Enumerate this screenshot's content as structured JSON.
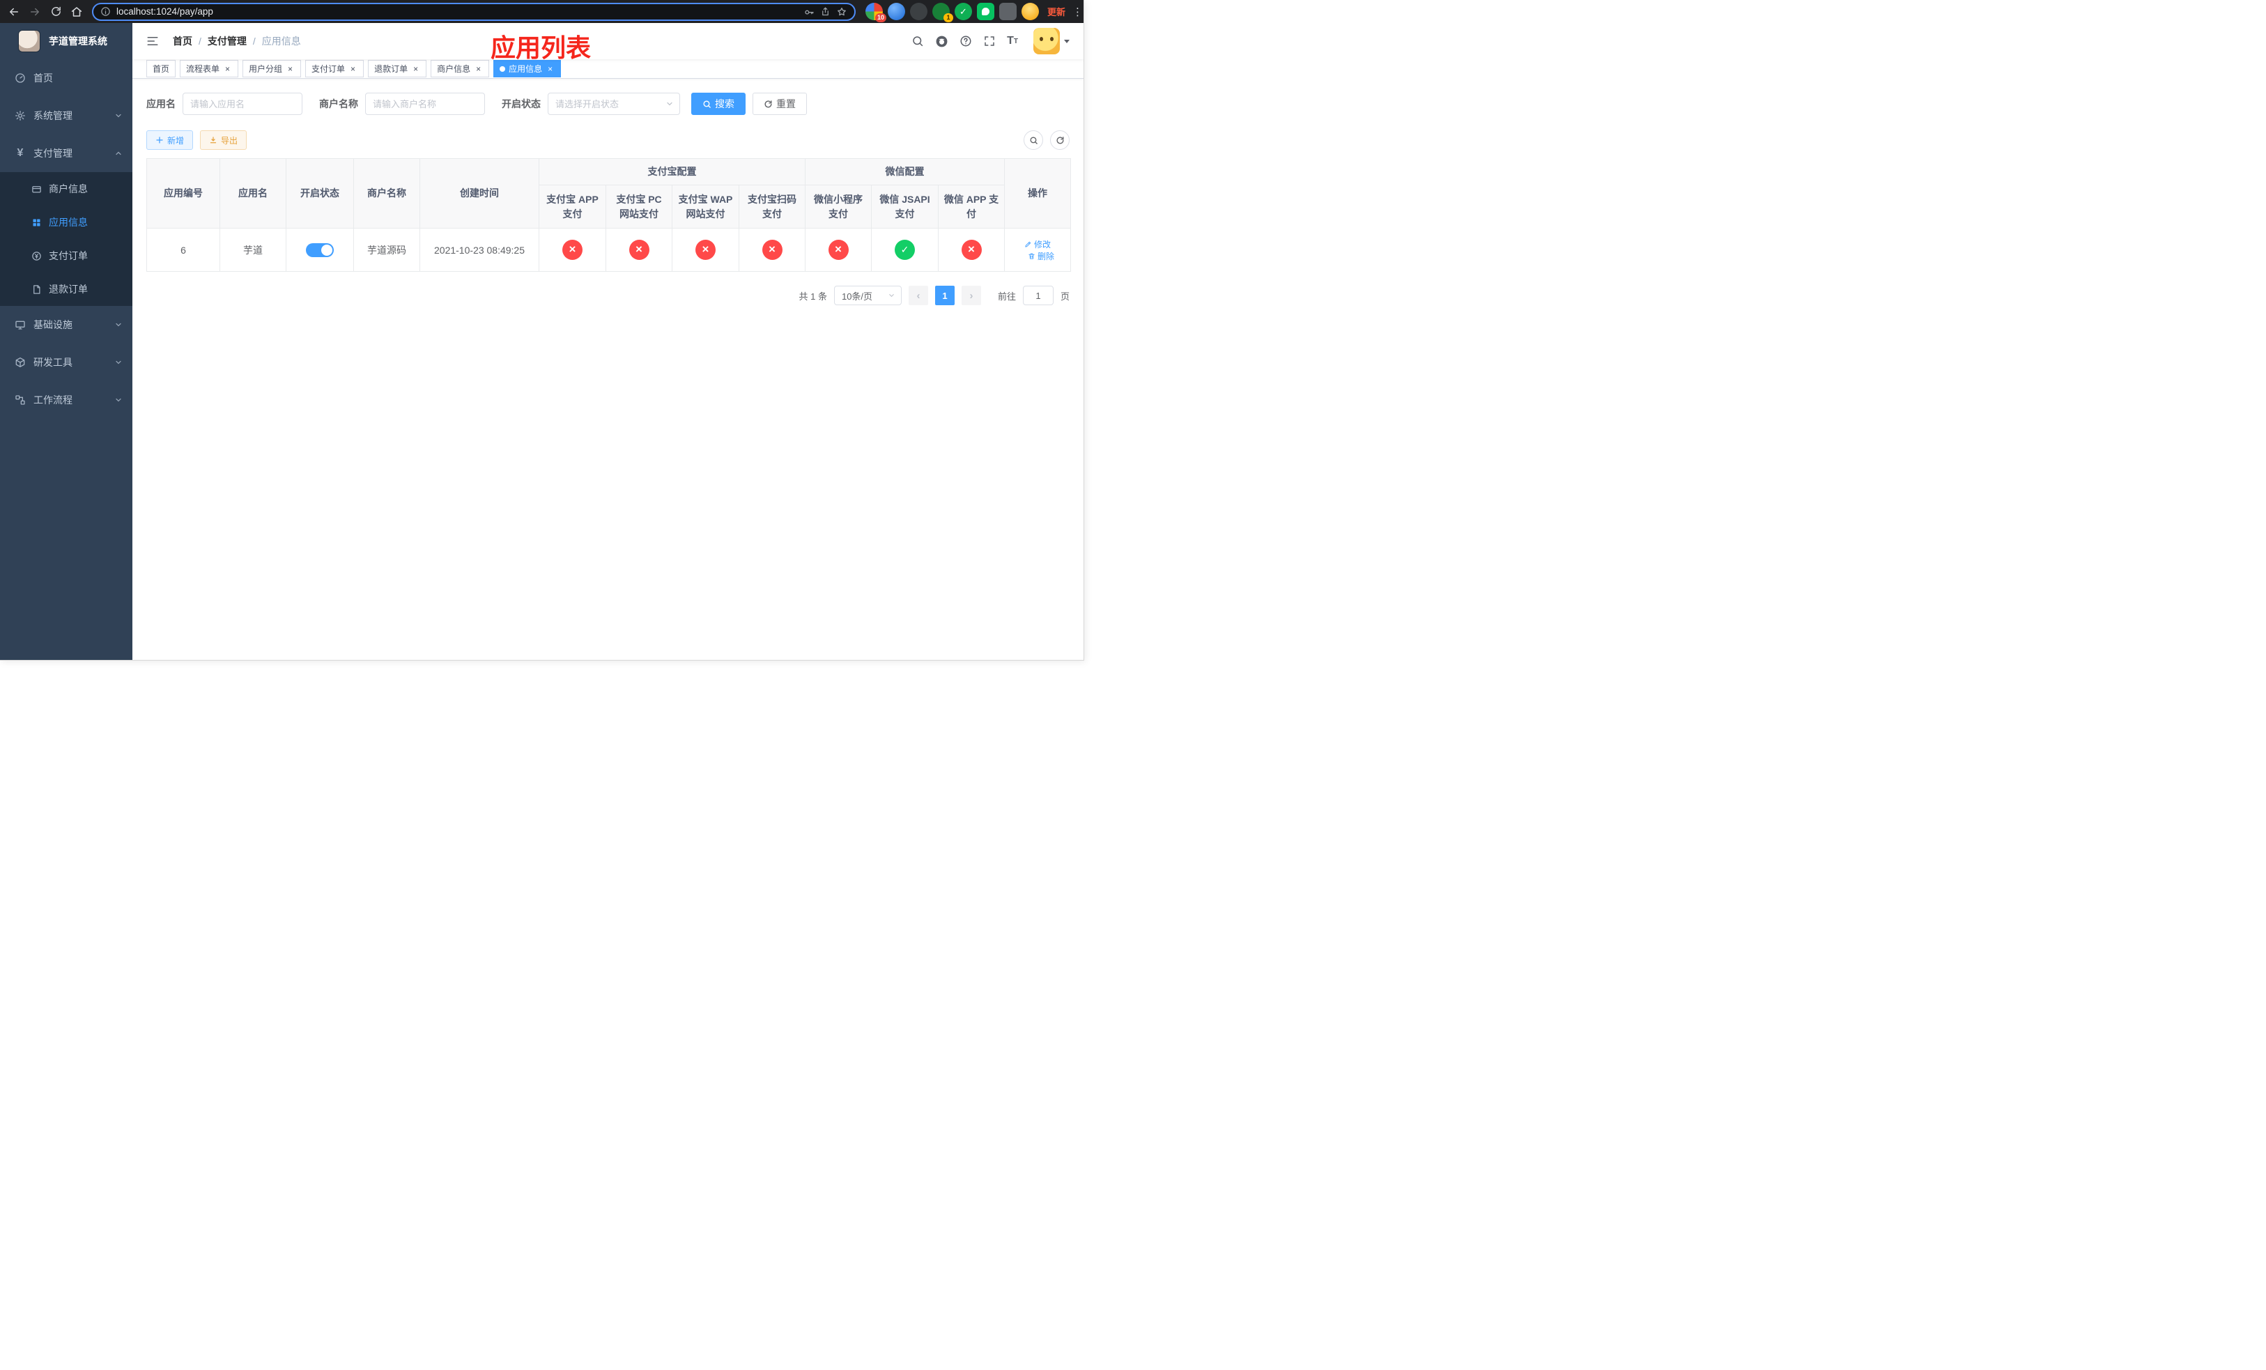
{
  "colors": {
    "accent": "#409eff",
    "success_circle": "#13ce66",
    "danger_circle": "#ff4949",
    "warning": "#e6a23c",
    "annotation_red": "#f5261c",
    "sidebar_bg": "#304156",
    "sidebar_submenu_bg": "#1f2d3d",
    "chrome_bg": "#202124",
    "update_chip": "#fb5a3c"
  },
  "browser": {
    "url": "localhost:1024/pay/app",
    "update_button": "更新",
    "extension_badge_a": "10",
    "extension_badge_b": "1"
  },
  "sidebar": {
    "title": "芋道管理系统",
    "items": [
      {
        "label": "首页"
      },
      {
        "label": "系统管理"
      },
      {
        "label": "支付管理"
      },
      {
        "label": "商户信息"
      },
      {
        "label": "应用信息"
      },
      {
        "label": "支付订单"
      },
      {
        "label": "退款订单"
      },
      {
        "label": "基础设施"
      },
      {
        "label": "研发工具"
      },
      {
        "label": "工作流程"
      }
    ]
  },
  "breadcrumb": {
    "separator": "/",
    "items": [
      "首页",
      "支付管理",
      "应用信息"
    ]
  },
  "annotation": {
    "text": "应用列表"
  },
  "tabs": [
    {
      "label": "首页"
    },
    {
      "label": "流程表单"
    },
    {
      "label": "用户分组"
    },
    {
      "label": "支付订单"
    },
    {
      "label": "退款订单"
    },
    {
      "label": "商户信息"
    },
    {
      "label": "应用信息"
    }
  ],
  "filter": {
    "app_name_label": "应用名",
    "app_name_placeholder": "请输入应用名",
    "merchant_label": "商户名称",
    "merchant_placeholder": "请输入商户名称",
    "status_label": "开启状态",
    "status_placeholder": "请选择开启状态",
    "search_button": "搜索",
    "reset_button": "重置"
  },
  "toolbar": {
    "add_button": "新增",
    "export_button": "导出"
  },
  "table": {
    "headers": {
      "app_id": "应用编号",
      "app_name": "应用名",
      "status": "开启状态",
      "merchant": "商户名称",
      "created": "创建时间",
      "alipay_group": "支付宝配置",
      "wechat_group": "微信配置",
      "alipay_app": "支付宝 APP 支付",
      "alipay_pc": "支付宝 PC 网站支付",
      "alipay_wap": "支付宝 WAP 网站支付",
      "alipay_qr": "支付宝扫码支付",
      "wx_mini": "微信小程序支付",
      "wx_jsapi": "微信 JSAPI 支付",
      "wx_app": "微信 APP 支付",
      "actions": "操作"
    },
    "row": {
      "app_id": "6",
      "app_name": "芋道",
      "enabled": "on",
      "merchant": "芋道源码",
      "created": "2021-10-23 08:49:25",
      "alipay_app": "no",
      "alipay_pc": "no",
      "alipay_wap": "no",
      "alipay_qr": "no",
      "wx_mini": "no",
      "wx_jsapi": "yes",
      "wx_app": "no",
      "edit_label": "修改",
      "delete_label": "删除"
    }
  },
  "pagination": {
    "total": "共 1 条",
    "page_size": "10条/页",
    "current_page": "1",
    "goto_label": "前往",
    "goto_value": "1",
    "goto_suffix": "页"
  }
}
